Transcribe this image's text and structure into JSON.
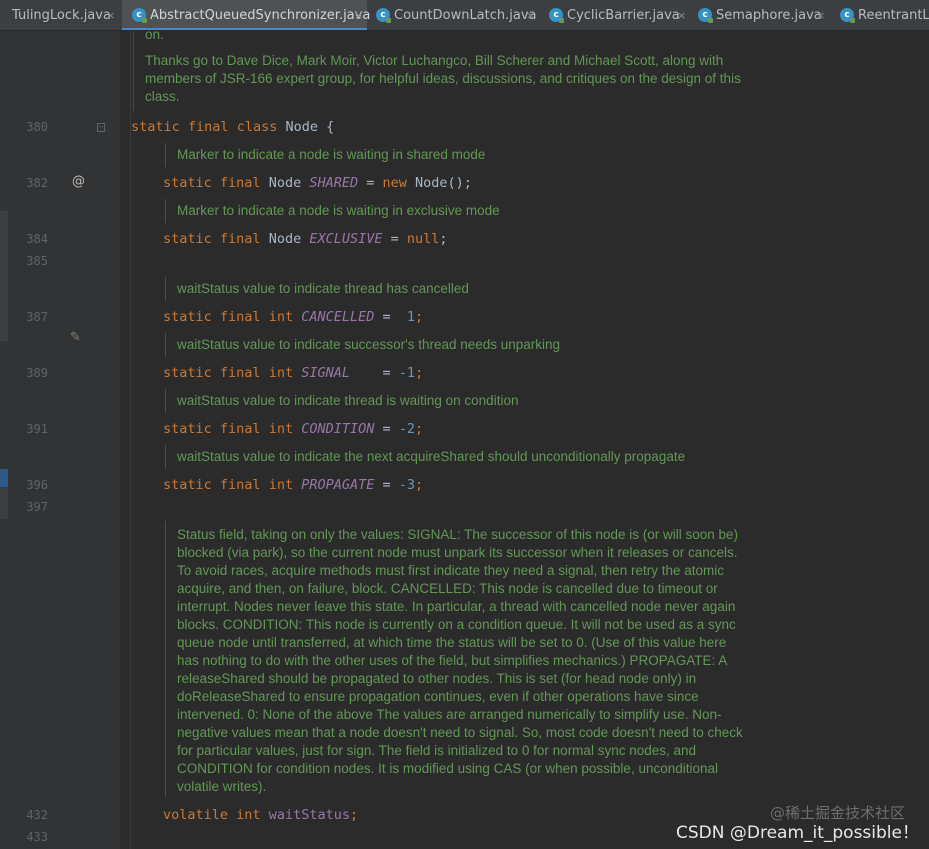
{
  "tabs": [
    {
      "label": "TulingLock.java",
      "icon": "none"
    },
    {
      "label": "AbstractQueuedSynchronizer.java",
      "icon": "class-icon",
      "active": true
    },
    {
      "label": "CountDownLatch.java",
      "icon": "class-icon"
    },
    {
      "label": "CyclicBarrier.java",
      "icon": "class-icon"
    },
    {
      "label": "Semaphore.java",
      "icon": "class-icon"
    },
    {
      "label": "ReentrantLo",
      "icon": "class-icon"
    }
  ],
  "close_glyph": "×",
  "class_icon_glyph": "c",
  "line_numbers": [
    "380",
    "382",
    "384",
    "385",
    "387",
    "389",
    "391",
    "396",
    "397",
    "432",
    "433"
  ],
  "header_doc": {
    "line0": "on.",
    "para": [
      "Thanks go to Dave Dice, Mark Moir, Victor Luchangco, Bill Scherer and Michael Scott, along with",
      "members of JSR-166 expert group, for helpful ideas, discussions, and critiques on the design of this",
      "class."
    ]
  },
  "code": {
    "class_decl": {
      "kw1": "static",
      "kw2": "final",
      "kw3": "class",
      "rest": " Node {"
    },
    "doc_shared": "Marker to indicate a node is waiting in shared mode",
    "line_shared": {
      "kw1": "static",
      "kw2": "final",
      "type": " Node ",
      "name": "SHARED",
      "eq": " = ",
      "kw3": "new",
      "rest": " Node();"
    },
    "doc_exclusive": "Marker to indicate a node is waiting in exclusive mode",
    "line_exclusive": {
      "kw1": "static",
      "kw2": "final",
      "type": " Node ",
      "name": "EXCLUSIVE",
      "eq": " = ",
      "kw3": "null",
      "rest": ";"
    },
    "doc_cancelled": "waitStatus value to indicate thread has cancelled",
    "line_cancelled": {
      "kw1": "static",
      "kw2": "final",
      "kw3": "int",
      "name": "CANCELLED",
      "eq": " =  ",
      "val": "1",
      "end": ";"
    },
    "doc_signal": "waitStatus value to indicate successor's thread needs unparking",
    "line_signal": {
      "kw1": "static",
      "kw2": "final",
      "kw3": "int",
      "name": "SIGNAL",
      "eq": "    = ",
      "val": "-1",
      "end": ";"
    },
    "doc_condition": "waitStatus value to indicate thread is waiting on condition",
    "line_condition": {
      "kw1": "static",
      "kw2": "final",
      "kw3": "int",
      "name": "CONDITION",
      "eq": " = ",
      "val": "-2",
      "end": ";"
    },
    "doc_propagate": "waitStatus value to indicate the next acquireShared should unconditionally propagate",
    "line_propagate": {
      "kw1": "static",
      "kw2": "final",
      "kw3": "int",
      "name": "PROPAGATE",
      "eq": " = ",
      "val": "-3",
      "end": ";"
    },
    "doc_status": [
      "Status field, taking on only the values: SIGNAL: The successor of this node is (or will soon be)",
      "blocked (via park), so the current node must unpark its successor when it releases or cancels.",
      "To avoid races, acquire methods must first indicate they need a signal, then retry the atomic",
      "acquire, and then, on failure, block. CANCELLED: This node is cancelled due to timeout or",
      "interrupt. Nodes never leave this state. In particular, a thread with cancelled node never again",
      "blocks. CONDITION: This node is currently on a condition queue. It will not be used as a sync",
      "queue node until transferred, at which time the status will be set to 0. (Use of this value here",
      "has nothing to do with the other uses of the field, but simplifies mechanics.) PROPAGATE: A",
      "releaseShared should be propagated to other nodes. This is set (for head node only) in",
      "doReleaseShared to ensure propagation continues, even if other operations have since",
      "intervened. 0: None of the above The values are arranged numerically to simplify use. Non-",
      "negative values mean that a node doesn't need to signal. So, most code doesn't need to check",
      "for particular values, just for sign. The field is initialized to 0 for normal sync nodes, and",
      "CONDITION for condition nodes. It is modified using CAS (or when possible, unconditional",
      "volatile writes)."
    ],
    "line_waitstatus": {
      "kw1": "volatile",
      "kw2": "int",
      "name": "waitStatus",
      "end": ";"
    }
  },
  "watermark": {
    "line1": "@稀土掘金技术社区",
    "line2": "CSDN @Dream_it_possible！"
  }
}
